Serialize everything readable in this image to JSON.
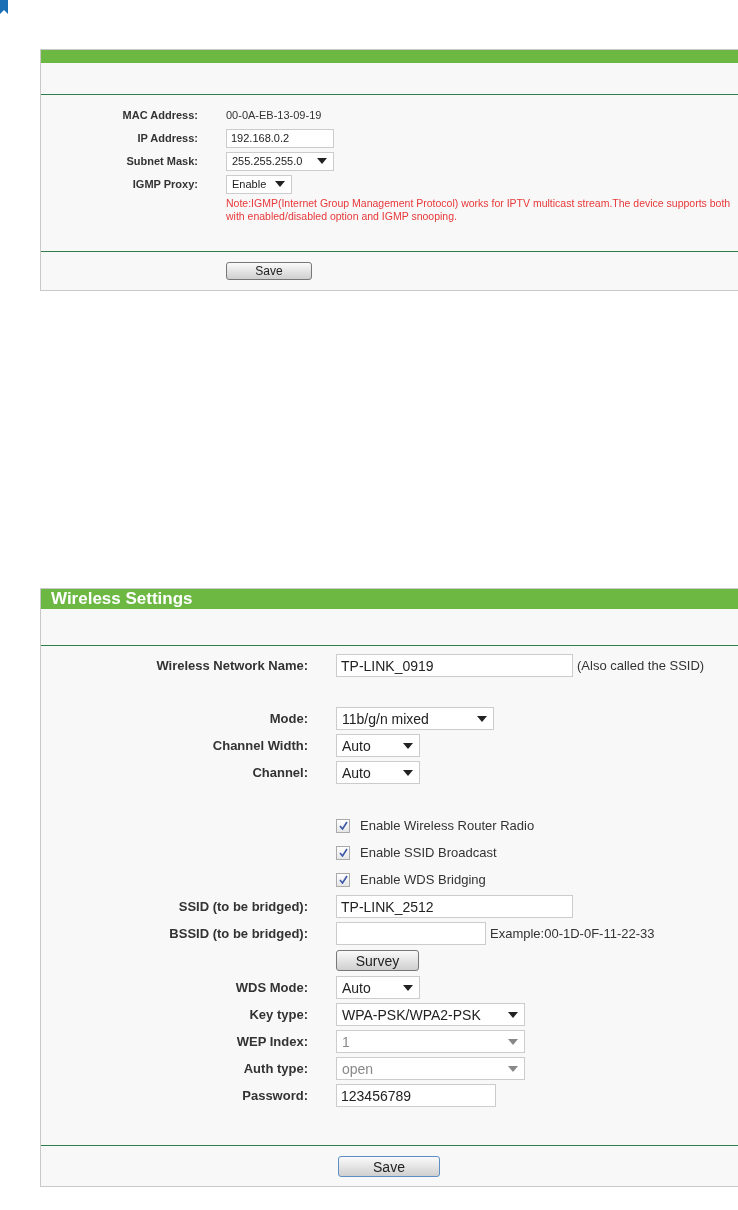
{
  "sections": [
    {
      "groups": [
        [
          {
            "kind": "text",
            "label": "MAC Address:",
            "value": "00-0A-EB-13-09-19"
          },
          {
            "kind": "input",
            "label": "IP Address:",
            "value": "192.168.0.2"
          },
          {
            "kind": "select",
            "label": "Subnet Mask:",
            "value": "255.255.255.0",
            "disabled": false
          },
          {
            "kind": "select",
            "label": "IGMP Proxy:",
            "value": "Enable",
            "disabled": false
          },
          {
            "kind": "note",
            "lines": [
              "Note:IGMP(Internet Group Management Protocol) works for IPTV multicast stream.The device supports both",
              "with enabled/disabled option and IGMP snooping."
            ]
          }
        ]
      ],
      "save": "Save"
    },
    {
      "title": "Wireless Settings",
      "groups": [
        [
          {
            "kind": "input",
            "label": "Wireless Network Name:",
            "value": "TP-LINK_0919",
            "suffix": "(Also called the SSID)"
          }
        ],
        [
          {
            "kind": "select",
            "label": "Mode:",
            "value": "11b/g/n mixed",
            "disabled": false
          },
          {
            "kind": "select",
            "label": "Channel Width:",
            "value": "Auto",
            "disabled": false
          },
          {
            "kind": "select",
            "label": "Channel:",
            "value": "Auto",
            "disabled": false
          }
        ],
        [
          {
            "kind": "checkbox",
            "label": "Enable Wireless Router Radio",
            "checked": true
          },
          {
            "kind": "checkbox",
            "label": "Enable SSID Broadcast",
            "checked": true
          },
          {
            "kind": "checkbox",
            "label": "Enable WDS Bridging",
            "checked": true
          },
          {
            "kind": "input",
            "label": "SSID (to be bridged):",
            "value": "TP-LINK_2512"
          },
          {
            "kind": "input",
            "label": "BSSID (to be bridged):",
            "suffix": "Example:00-1D-0F-11-22-33"
          },
          {
            "kind": "button",
            "label": "Survey"
          },
          {
            "kind": "select",
            "label": "WDS Mode:",
            "value": "Auto",
            "disabled": false
          },
          {
            "kind": "select",
            "label": "Key type:",
            "value": "WPA-PSK/WPA2-PSK",
            "disabled": false
          },
          {
            "kind": "select",
            "label": "WEP Index:",
            "value": "1",
            "disabled": true
          },
          {
            "kind": "select",
            "label": "Auth type:",
            "value": "open",
            "disabled": true
          },
          {
            "kind": "input",
            "label": "Password:",
            "value": "123456789"
          }
        ]
      ],
      "save": "Save"
    }
  ]
}
